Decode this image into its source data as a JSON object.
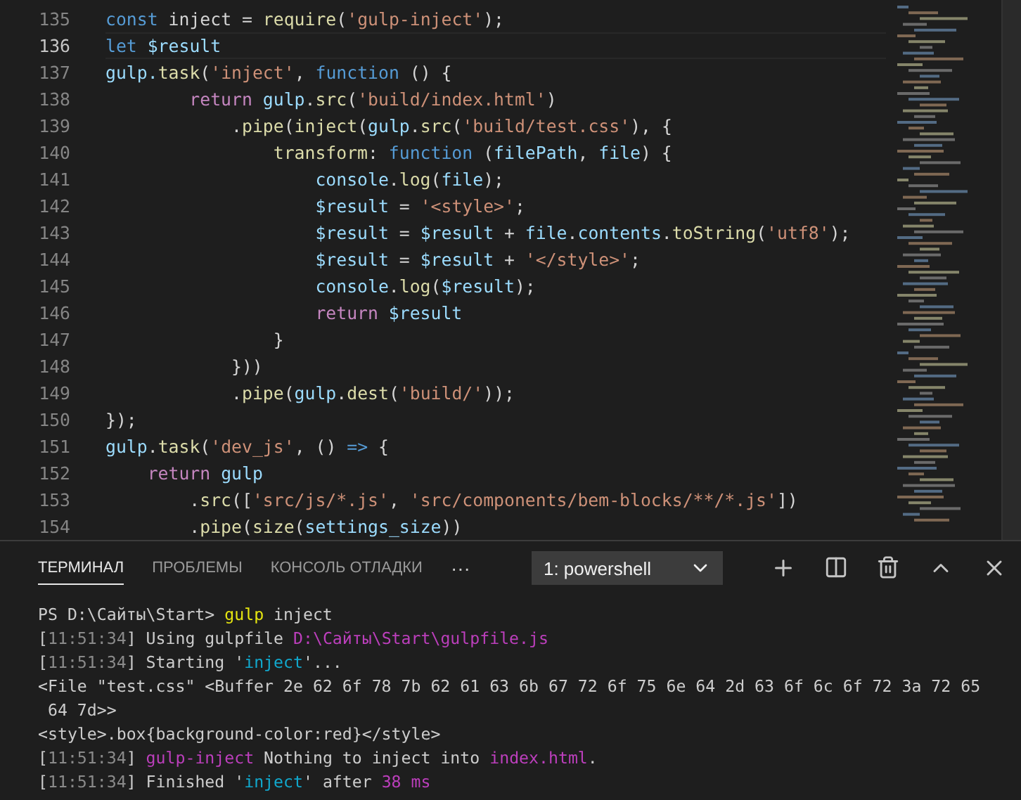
{
  "editor": {
    "lines": [
      {
        "number": "135",
        "current": false,
        "tokens": [
          {
            "text": "const",
            "kind": "keyword"
          },
          {
            "text": " inject = ",
            "kind": "plain"
          },
          {
            "text": "require",
            "kind": "function"
          },
          {
            "text": "(",
            "kind": "plain"
          },
          {
            "text": "'gulp-inject'",
            "kind": "string"
          },
          {
            "text": ");",
            "kind": "plain"
          }
        ]
      },
      {
        "number": "136",
        "current": true,
        "tokens": [
          {
            "text": "let",
            "kind": "keyword"
          },
          {
            "text": " $result",
            "kind": "variable"
          }
        ]
      },
      {
        "number": "137",
        "current": false,
        "tokens": [
          {
            "text": "gulp.",
            "kind": "variable"
          },
          {
            "text": "task",
            "kind": "function"
          },
          {
            "text": "(",
            "kind": "plain"
          },
          {
            "text": "'inject'",
            "kind": "string"
          },
          {
            "text": ", ",
            "kind": "plain"
          },
          {
            "text": "function",
            "kind": "keyword"
          },
          {
            "text": " () {",
            "kind": "plain"
          }
        ]
      },
      {
        "number": "138",
        "current": false,
        "tokens": [
          {
            "text": "        return",
            "kind": "control"
          },
          {
            "text": " gulp",
            "kind": "variable"
          },
          {
            "text": ".",
            "kind": "plain"
          },
          {
            "text": "src",
            "kind": "function"
          },
          {
            "text": "(",
            "kind": "plain"
          },
          {
            "text": "'build/index.html'",
            "kind": "string"
          },
          {
            "text": ")",
            "kind": "plain"
          }
        ]
      },
      {
        "number": "139",
        "current": false,
        "tokens": [
          {
            "text": "            .",
            "kind": "plain"
          },
          {
            "text": "pipe",
            "kind": "function"
          },
          {
            "text": "(",
            "kind": "plain"
          },
          {
            "text": "inject",
            "kind": "function"
          },
          {
            "text": "(",
            "kind": "plain"
          },
          {
            "text": "gulp",
            "kind": "variable"
          },
          {
            "text": ".",
            "kind": "plain"
          },
          {
            "text": "src",
            "kind": "function"
          },
          {
            "text": "(",
            "kind": "plain"
          },
          {
            "text": "'build/test.css'",
            "kind": "string"
          },
          {
            "text": "), {",
            "kind": "plain"
          }
        ]
      },
      {
        "number": "140",
        "current": false,
        "tokens": [
          {
            "text": "                transform",
            "kind": "function"
          },
          {
            "text": ": ",
            "kind": "plain"
          },
          {
            "text": "function",
            "kind": "keyword"
          },
          {
            "text": " (",
            "kind": "plain"
          },
          {
            "text": "filePath",
            "kind": "variable"
          },
          {
            "text": ", ",
            "kind": "plain"
          },
          {
            "text": "file",
            "kind": "variable"
          },
          {
            "text": ") {",
            "kind": "plain"
          }
        ]
      },
      {
        "number": "141",
        "current": false,
        "tokens": [
          {
            "text": "                    console",
            "kind": "variable"
          },
          {
            "text": ".",
            "kind": "plain"
          },
          {
            "text": "log",
            "kind": "function"
          },
          {
            "text": "(",
            "kind": "plain"
          },
          {
            "text": "file",
            "kind": "variable"
          },
          {
            "text": ");",
            "kind": "plain"
          }
        ]
      },
      {
        "number": "142",
        "current": false,
        "tokens": [
          {
            "text": "                    $result",
            "kind": "variable"
          },
          {
            "text": " = ",
            "kind": "plain"
          },
          {
            "text": "'<style>'",
            "kind": "string"
          },
          {
            "text": ";",
            "kind": "plain"
          }
        ]
      },
      {
        "number": "143",
        "current": false,
        "tokens": [
          {
            "text": "                    $result",
            "kind": "variable"
          },
          {
            "text": " = ",
            "kind": "plain"
          },
          {
            "text": "$result",
            "kind": "variable"
          },
          {
            "text": " + ",
            "kind": "plain"
          },
          {
            "text": "file",
            "kind": "variable"
          },
          {
            "text": ".",
            "kind": "plain"
          },
          {
            "text": "contents",
            "kind": "variable"
          },
          {
            "text": ".",
            "kind": "plain"
          },
          {
            "text": "toString",
            "kind": "function"
          },
          {
            "text": "(",
            "kind": "plain"
          },
          {
            "text": "'utf8'",
            "kind": "string"
          },
          {
            "text": ");",
            "kind": "plain"
          }
        ]
      },
      {
        "number": "144",
        "current": false,
        "tokens": [
          {
            "text": "                    $result",
            "kind": "variable"
          },
          {
            "text": " = ",
            "kind": "plain"
          },
          {
            "text": "$result",
            "kind": "variable"
          },
          {
            "text": " + ",
            "kind": "plain"
          },
          {
            "text": "'</style>'",
            "kind": "string"
          },
          {
            "text": ";",
            "kind": "plain"
          }
        ]
      },
      {
        "number": "145",
        "current": false,
        "tokens": [
          {
            "text": "                    console",
            "kind": "variable"
          },
          {
            "text": ".",
            "kind": "plain"
          },
          {
            "text": "log",
            "kind": "function"
          },
          {
            "text": "(",
            "kind": "plain"
          },
          {
            "text": "$result",
            "kind": "variable"
          },
          {
            "text": ");",
            "kind": "plain"
          }
        ]
      },
      {
        "number": "146",
        "current": false,
        "tokens": [
          {
            "text": "                    return",
            "kind": "control"
          },
          {
            "text": " $result",
            "kind": "variable"
          }
        ]
      },
      {
        "number": "147",
        "current": false,
        "tokens": [
          {
            "text": "                }",
            "kind": "plain"
          }
        ]
      },
      {
        "number": "148",
        "current": false,
        "tokens": [
          {
            "text": "            }))",
            "kind": "plain"
          }
        ]
      },
      {
        "number": "149",
        "current": false,
        "tokens": [
          {
            "text": "            .",
            "kind": "plain"
          },
          {
            "text": "pipe",
            "kind": "function"
          },
          {
            "text": "(",
            "kind": "plain"
          },
          {
            "text": "gulp",
            "kind": "variable"
          },
          {
            "text": ".",
            "kind": "plain"
          },
          {
            "text": "dest",
            "kind": "function"
          },
          {
            "text": "(",
            "kind": "plain"
          },
          {
            "text": "'build/'",
            "kind": "string"
          },
          {
            "text": "));",
            "kind": "plain"
          }
        ]
      },
      {
        "number": "150",
        "current": false,
        "tokens": [
          {
            "text": "});",
            "kind": "plain"
          }
        ]
      },
      {
        "number": "151",
        "current": false,
        "tokens": [
          {
            "text": "gulp",
            "kind": "variable"
          },
          {
            "text": ".",
            "kind": "plain"
          },
          {
            "text": "task",
            "kind": "function"
          },
          {
            "text": "(",
            "kind": "plain"
          },
          {
            "text": "'dev_js'",
            "kind": "string"
          },
          {
            "text": ", () ",
            "kind": "plain"
          },
          {
            "text": "=>",
            "kind": "keyword"
          },
          {
            "text": " {",
            "kind": "plain"
          }
        ]
      },
      {
        "number": "152",
        "current": false,
        "tokens": [
          {
            "text": "    return",
            "kind": "control"
          },
          {
            "text": " gulp",
            "kind": "variable"
          }
        ]
      },
      {
        "number": "153",
        "current": false,
        "tokens": [
          {
            "text": "        .",
            "kind": "plain"
          },
          {
            "text": "src",
            "kind": "function"
          },
          {
            "text": "([",
            "kind": "plain"
          },
          {
            "text": "'src/js/*.js'",
            "kind": "string"
          },
          {
            "text": ", ",
            "kind": "plain"
          },
          {
            "text": "'src/components/bem-blocks/**/*.js'",
            "kind": "string"
          },
          {
            "text": "])",
            "kind": "plain"
          }
        ]
      },
      {
        "number": "154",
        "current": false,
        "tokens": [
          {
            "text": "        .",
            "kind": "plain"
          },
          {
            "text": "pipe",
            "kind": "function"
          },
          {
            "text": "(",
            "kind": "plain"
          },
          {
            "text": "size",
            "kind": "function"
          },
          {
            "text": "(",
            "kind": "plain"
          },
          {
            "text": "settings_size",
            "kind": "variable"
          },
          {
            "text": "))",
            "kind": "plain"
          }
        ]
      }
    ]
  },
  "panel": {
    "tabs": [
      {
        "label": "ТЕРМИНАЛ",
        "selected": true
      },
      {
        "label": "ПРОБЛЕМЫ",
        "selected": false
      },
      {
        "label": "КОНСОЛЬ ОТЛАДКИ",
        "selected": false
      }
    ],
    "more": "···",
    "terminal_select": {
      "value": "1: powershell"
    },
    "terminal": [
      {
        "tokens": [
          {
            "text": "PS D:\\Сайты\\Start> ",
            "kind": "plain"
          },
          {
            "text": "gulp",
            "kind": "command"
          },
          {
            "text": " inject",
            "kind": "plain"
          }
        ]
      },
      {
        "tokens": [
          {
            "text": "[",
            "kind": "plain"
          },
          {
            "text": "11:51:34",
            "kind": "time"
          },
          {
            "text": "] Using gulpfile ",
            "kind": "plain"
          },
          {
            "text": "D:\\Сайты\\Start\\gulpfile.js",
            "kind": "magenta"
          }
        ]
      },
      {
        "tokens": [
          {
            "text": "[",
            "kind": "plain"
          },
          {
            "text": "11:51:34",
            "kind": "time"
          },
          {
            "text": "] Starting '",
            "kind": "plain"
          },
          {
            "text": "inject",
            "kind": "cyan"
          },
          {
            "text": "'...",
            "kind": "plain"
          }
        ]
      },
      {
        "tokens": [
          {
            "text": "<File \"test.css\" <Buffer 2e 62 6f 78 7b 62 61 63 6b 67 72 6f 75 6e 64 2d 63 6f 6c 6f 72 3a 72 65",
            "kind": "plain"
          }
        ]
      },
      {
        "tokens": [
          {
            "text": " 64 7d>>",
            "kind": "plain"
          }
        ]
      },
      {
        "tokens": [
          {
            "text": "<style>.box{background-color:red}</style>",
            "kind": "plain"
          }
        ]
      },
      {
        "tokens": [
          {
            "text": "[",
            "kind": "plain"
          },
          {
            "text": "11:51:34",
            "kind": "time"
          },
          {
            "text": "] ",
            "kind": "plain"
          },
          {
            "text": "gulp-inject",
            "kind": "magenta"
          },
          {
            "text": " Nothing to inject into ",
            "kind": "plain"
          },
          {
            "text": "index.html",
            "kind": "magenta"
          },
          {
            "text": ".",
            "kind": "plain"
          }
        ]
      },
      {
        "tokens": [
          {
            "text": "[",
            "kind": "plain"
          },
          {
            "text": "11:51:34",
            "kind": "time"
          },
          {
            "text": "] Finished '",
            "kind": "plain"
          },
          {
            "text": "inject",
            "kind": "cyan"
          },
          {
            "text": "' after ",
            "kind": "plain"
          },
          {
            "text": "38 ms",
            "kind": "magenta"
          }
        ]
      }
    ]
  }
}
